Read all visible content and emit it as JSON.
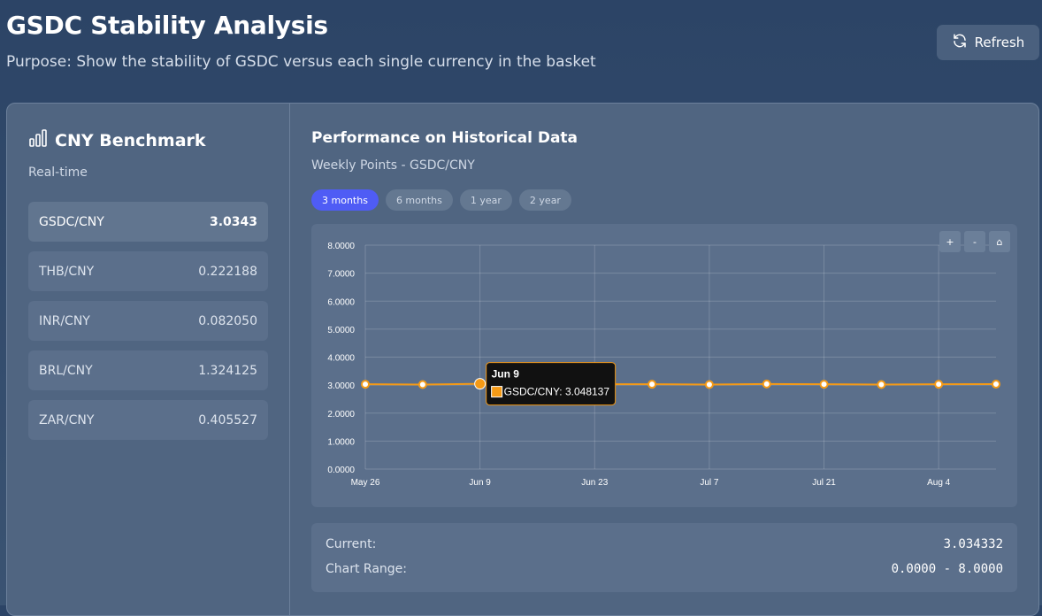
{
  "header": {
    "title": "GSDC Stability Analysis",
    "subtitle": "Purpose: Show the stability of GSDC versus each single currency in the basket",
    "refresh_label": "Refresh"
  },
  "benchmark": {
    "title": "CNY Benchmark",
    "subtitle": "Real-time",
    "rates": [
      {
        "pair": "GSDC/CNY",
        "value": "3.0343"
      },
      {
        "pair": "THB/CNY",
        "value": "0.222188"
      },
      {
        "pair": "INR/CNY",
        "value": "0.082050"
      },
      {
        "pair": "BRL/CNY",
        "value": "1.324125"
      },
      {
        "pair": "ZAR/CNY",
        "value": "0.405527"
      }
    ]
  },
  "performance": {
    "title": "Performance on Historical Data",
    "subtitle": "Weekly Points - GSDC/CNY",
    "ranges": [
      "3 months",
      "6 months",
      "1 year",
      "2 year"
    ],
    "active_range": "3 months",
    "zoom": {
      "in": "+",
      "out": "-",
      "reset": "⌂"
    },
    "tooltip": {
      "title": "Jun 9",
      "series": "GSDC/CNY",
      "value": "3.048137"
    }
  },
  "chart_data": {
    "type": "line",
    "x": [
      "May 26",
      "Jun 2",
      "Jun 9",
      "Jun 16",
      "Jun 23",
      "Jun 30",
      "Jul 7",
      "Jul 14",
      "Jul 21",
      "Jul 28",
      "Aug 4",
      "Aug 11"
    ],
    "x_tick_labels": [
      "May 26",
      "Jun 9",
      "Jun 23",
      "Jul 7",
      "Jul 21",
      "Aug 4"
    ],
    "series": [
      {
        "name": "GSDC/CNY",
        "values": [
          3.03,
          3.02,
          3.048137,
          3.03,
          3.03,
          3.03,
          3.02,
          3.04,
          3.03,
          3.02,
          3.03,
          3.034332
        ]
      }
    ],
    "ylim": [
      0,
      8
    ],
    "y_ticks": [
      "0.0000",
      "1.0000",
      "2.0000",
      "3.0000",
      "4.0000",
      "5.0000",
      "6.0000",
      "7.0000",
      "8.0000"
    ],
    "grid": true,
    "line_color": "#f59a16",
    "highlight_index": 2
  },
  "summary": {
    "current_label": "Current:",
    "current_value": "3.034332",
    "range_label": "Chart Range:",
    "range_value": "0.0000 - 8.0000"
  }
}
